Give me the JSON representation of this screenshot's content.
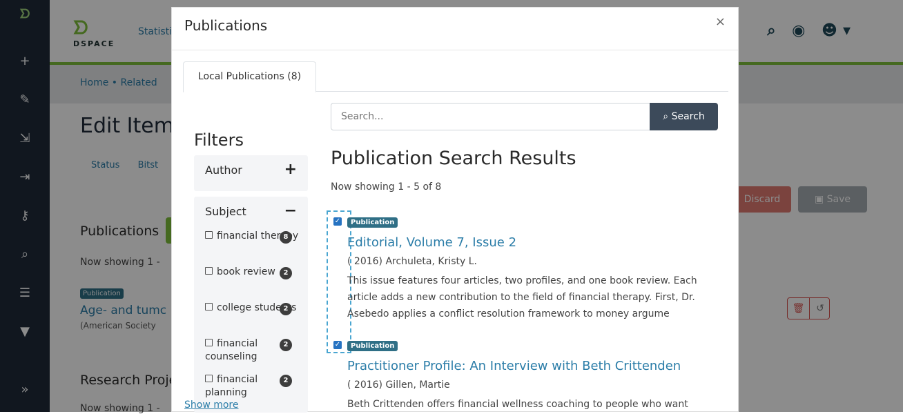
{
  "background": {
    "navbar": {
      "partial_text": "Statisti"
    },
    "breadcrumb": "Home • Related",
    "page_title": "Edit Item",
    "tabs": [
      "Status",
      "Bitst"
    ],
    "publications_label": "Publications",
    "showing": "Now showing 1 -",
    "item": {
      "badge": "Publication",
      "title": "Age- and tumc",
      "subtitle": "(American Society"
    },
    "research_label": "Research Proje",
    "showing2": "Now showing 1 -",
    "discard_label": "Discard",
    "save_label": "Save"
  },
  "modal": {
    "title": "Publications",
    "close": "×",
    "tab": "Local Publications (8)",
    "filters_title": "Filters",
    "filters": {
      "author": {
        "label": "Author",
        "toggle": "+"
      },
      "subject": {
        "label": "Subject",
        "toggle": "−",
        "items": [
          {
            "label": "financial therapy",
            "count": "8"
          },
          {
            "label": "book review",
            "count": "2"
          },
          {
            "label": "college students",
            "count": "2"
          },
          {
            "label": "financial counseling",
            "count": "2"
          },
          {
            "label": "financial planning",
            "count": "2"
          }
        ],
        "show_more": "Show more"
      }
    },
    "search": {
      "placeholder": "Search...",
      "button_label": "Search"
    },
    "results_title": "Publication Search Results",
    "results_showing": "Now showing 1 - 5 of 8",
    "results": [
      {
        "badge": "Publication",
        "title": "Editorial, Volume 7, Issue 2",
        "meta": "( 2016) Archuleta, Kristy L.",
        "abstract": "This issue features four articles, two profiles, and one book review. Each article adds a new contribution to the field of financial therapy. First, Dr. Asebedo applies a conflict resolution framework to money argume"
      },
      {
        "badge": "Publication",
        "title": "Practitioner Profile: An Interview with Beth Crittenden",
        "meta": "( 2016) Gillen, Martie",
        "abstract": "Beth Crittenden offers financial wellness coaching to people who want"
      }
    ]
  }
}
